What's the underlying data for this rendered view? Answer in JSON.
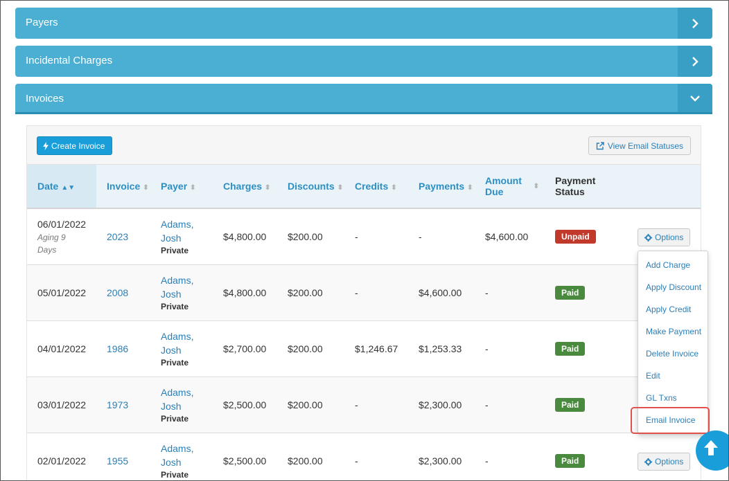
{
  "accordions": {
    "payers": {
      "title": "Payers"
    },
    "incidental": {
      "title": "Incidental Charges"
    },
    "invoices": {
      "title": "Invoices"
    }
  },
  "toolbar": {
    "create_label": "Create Invoice",
    "view_email_label": "View Email Statuses"
  },
  "table": {
    "headers": {
      "date": "Date",
      "invoice": "Invoice",
      "payer": "Payer",
      "charges": "Charges",
      "discounts": "Discounts",
      "credits": "Credits",
      "payments": "Payments",
      "amount_due_1": "Amount",
      "amount_due_2": "Due",
      "status_1": "Payment",
      "status_2": "Status"
    },
    "rows": [
      {
        "date": "06/01/2022",
        "aging_1": "Aging 9",
        "aging_2": "Days",
        "invoice": "2023",
        "payer_1": "Adams,",
        "payer_2": "Josh",
        "payer_type": "Private",
        "charges": "$4,800.00",
        "discounts": "$200.00",
        "credits": "-",
        "payments": "-",
        "amount_due": "$4,600.00",
        "status": "Unpaid"
      },
      {
        "date": "05/01/2022",
        "invoice": "2008",
        "payer_1": "Adams,",
        "payer_2": "Josh",
        "payer_type": "Private",
        "charges": "$4,800.00",
        "discounts": "$200.00",
        "credits": "-",
        "payments": "$4,600.00",
        "amount_due": "-",
        "status": "Paid"
      },
      {
        "date": "04/01/2022",
        "invoice": "1986",
        "payer_1": "Adams,",
        "payer_2": "Josh",
        "payer_type": "Private",
        "charges": "$2,700.00",
        "discounts": "$200.00",
        "credits": "$1,246.67",
        "payments": "$1,253.33",
        "amount_due": "-",
        "status": "Paid"
      },
      {
        "date": "03/01/2022",
        "invoice": "1973",
        "payer_1": "Adams,",
        "payer_2": "Josh",
        "payer_type": "Private",
        "charges": "$2,500.00",
        "discounts": "$200.00",
        "credits": "-",
        "payments": "$2,300.00",
        "amount_due": "-",
        "status": "Paid"
      },
      {
        "date": "02/01/2022",
        "invoice": "1955",
        "payer_1": "Adams,",
        "payer_2": "Josh",
        "payer_type": "Private",
        "charges": "$2,500.00",
        "discounts": "$200.00",
        "credits": "-",
        "payments": "$2,300.00",
        "amount_due": "-",
        "status": "Paid"
      }
    ]
  },
  "options_label": "Options",
  "dropdown": {
    "items": [
      "Add Charge",
      "Apply Discount",
      "Apply Credit",
      "Make Payment",
      "Delete Invoice",
      "Edit",
      "GL Txns",
      "Email Invoice"
    ]
  },
  "icons": {
    "accordion_closed": "chevron-right-icon",
    "accordion_open": "chevron-down-icon",
    "create": "bolt-icon",
    "view_email": "external-link-icon",
    "options": "gear-icon",
    "scroll_top": "arrow-up-icon"
  },
  "colors": {
    "accordion": "#4aafd3",
    "primary": "#1a9ed9",
    "link": "#2a7fb8",
    "unpaid": "#c0392b",
    "paid": "#4a8a3f",
    "highlight": "#e0514d"
  }
}
